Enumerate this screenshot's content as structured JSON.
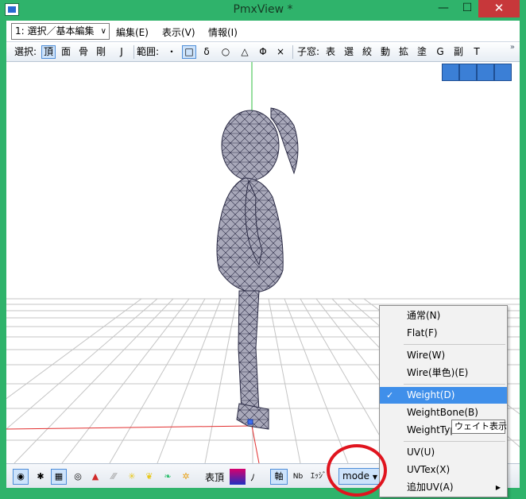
{
  "window": {
    "title": "PmxView *",
    "minimize_icon": "minimize-icon",
    "maximize_icon": "maximize-icon",
    "close_icon": "close-icon"
  },
  "menubar": {
    "mode_select": "1: 選択／基本編集",
    "menus": [
      "編集(E)",
      "表示(V)",
      "情報(I)"
    ]
  },
  "toolstrip": {
    "select_label": "選択:",
    "select_buttons": [
      "頂",
      "面",
      "骨",
      "剛",
      "J"
    ],
    "range_label": "範囲:",
    "range_buttons": [
      "・",
      "□",
      "δ",
      "○",
      "△",
      "Φ",
      "×"
    ],
    "child_label": "子窓:",
    "child_buttons": [
      "表",
      "選",
      "絞",
      "動",
      "拡",
      "塗",
      "G",
      "副",
      "T"
    ]
  },
  "bottombar": {
    "show_vertex_label": "表頂",
    "no_label": "ﾉ",
    "axis_label": "軸",
    "nmb_label": "Nb",
    "edge_label": "ｴｯｼﾞ",
    "mode_label": "mode"
  },
  "dropdown": {
    "items": [
      {
        "label": "通常(N)"
      },
      {
        "label": "Flat(F)"
      },
      {
        "label": "Wire(W)"
      },
      {
        "label": "Wire(単色)(E)"
      },
      {
        "label": "Weight(D)",
        "checked": true
      },
      {
        "label": "WeightBone(B)"
      },
      {
        "label": "WeightTyp"
      },
      {
        "label": "UV(U)"
      },
      {
        "label": "UVTex(X)"
      },
      {
        "label": "追加UV(A)",
        "submenu": true
      }
    ],
    "tooltip": "ウェイト表示"
  },
  "colors": {
    "titlebar": "#2fb36b",
    "highlight": "#3f8fea",
    "annotation": "#e0141e",
    "model_fill": "#a9a9ba",
    "model_wire": "#2a2a44"
  }
}
